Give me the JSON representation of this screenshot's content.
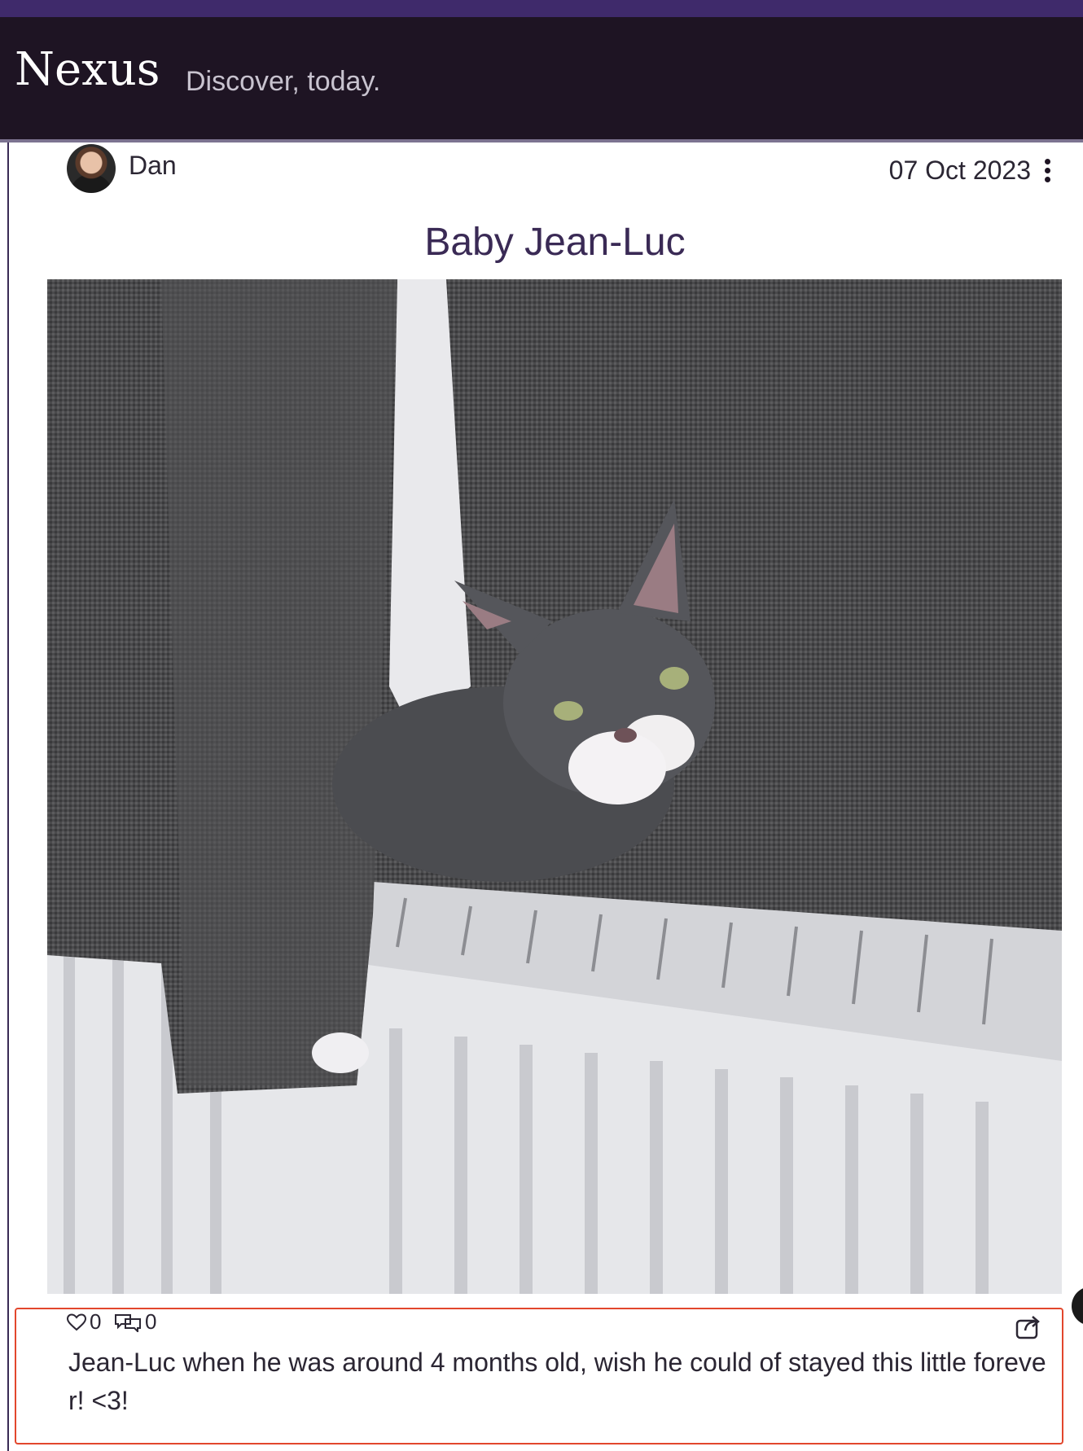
{
  "header": {
    "logo": "Nexus",
    "tagline": "Discover, today."
  },
  "post": {
    "author": "Dan",
    "date": "07 Oct 2023",
    "title": "Baby Jean-Luc",
    "likes": "0",
    "comments": "0",
    "description": "Jean-Luc when he was around 4 months old, wish he could of stayed this little forever! <3!"
  },
  "colors": {
    "header_bg": "#1e1423",
    "accent": "#3f2a6b",
    "highlight": "#e2472d"
  },
  "icons": {
    "more": "kebab-icon",
    "like": "heart-icon",
    "comment": "comment-icon",
    "share": "share-icon"
  }
}
